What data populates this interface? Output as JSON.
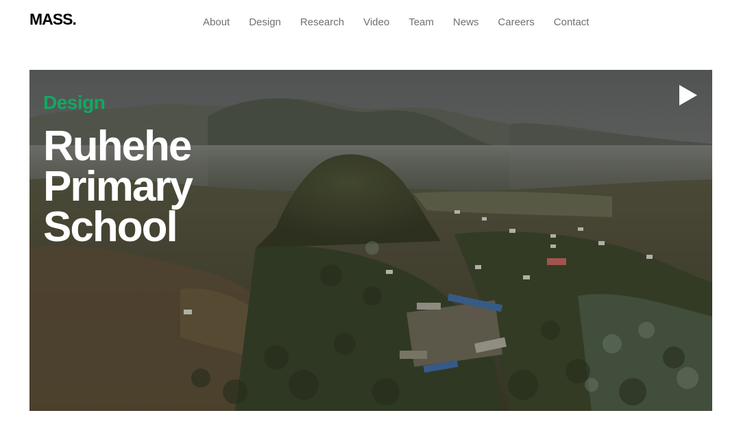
{
  "header": {
    "logo": "MASS.",
    "nav": [
      {
        "label": "About"
      },
      {
        "label": "Design"
      },
      {
        "label": "Research"
      },
      {
        "label": "Video"
      },
      {
        "label": "Team"
      },
      {
        "label": "News"
      },
      {
        "label": "Careers"
      },
      {
        "label": "Contact"
      }
    ]
  },
  "hero": {
    "category": "Design",
    "title": "Ruhehe Primary School",
    "play_icon": "play-icon",
    "category_color": "#13a860",
    "image": "aerial-landscape-image"
  }
}
